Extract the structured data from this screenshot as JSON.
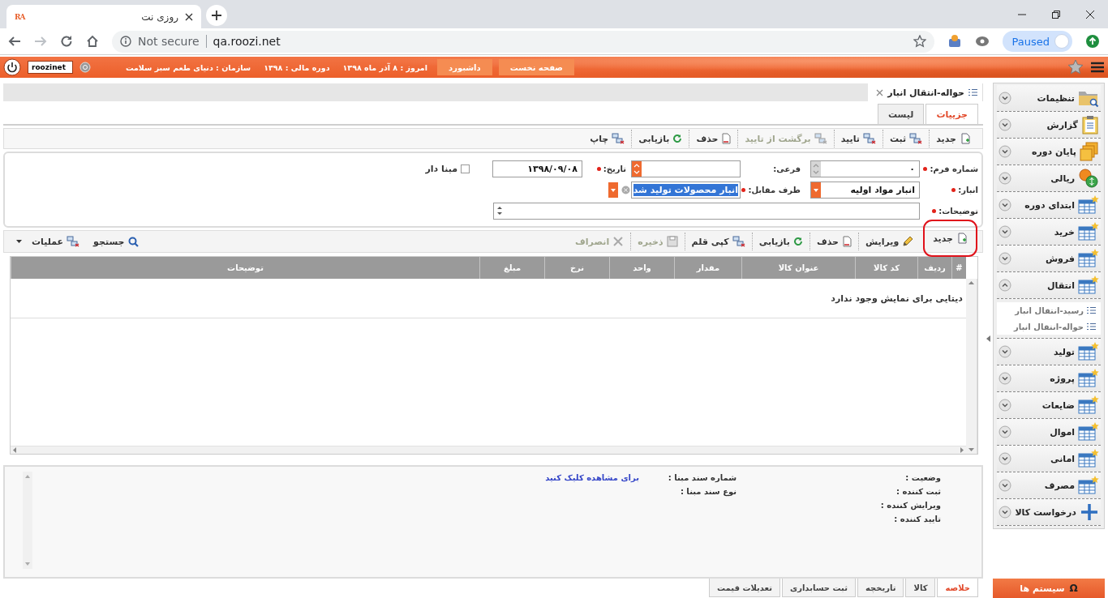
{
  "browser": {
    "favicon": "RA",
    "tab_title": "روزی نت",
    "security": "Not secure",
    "url": "qa.roozi.net",
    "profile_status": "Paused"
  },
  "header": {
    "buttons": [
      "صفحه نخست",
      "داشبورد"
    ],
    "info": [
      "امروز : ۸ آذر ماه ۱۳۹۸",
      "دوره مالی : ۱۳۹۸",
      "سازمان : دنیای طعم سبز سلامت"
    ],
    "user": "roozinet"
  },
  "document": {
    "title": "حواله-انتقال انبار",
    "tabs": [
      {
        "label": "جزییات",
        "selected": true
      },
      {
        "label": "لیست",
        "selected": false
      }
    ],
    "toolbar": [
      {
        "label": "جدید",
        "kind": "new",
        "disabled": false
      },
      {
        "label": "ثبت",
        "kind": "transfer",
        "disabled": false
      },
      {
        "label": "تایید",
        "kind": "transfer",
        "disabled": false
      },
      {
        "label": "برگشت از تایید",
        "kind": "transfer",
        "disabled": true
      },
      {
        "label": "حذف",
        "kind": "delete",
        "disabled": false
      },
      {
        "label": "بازیابی",
        "kind": "refresh",
        "disabled": false
      },
      {
        "label": "چاپ",
        "kind": "transfer",
        "disabled": false
      }
    ],
    "form": {
      "number": {
        "label": "شماره فرم:",
        "required": true,
        "value": "۰",
        "disabled": true
      },
      "sub": {
        "label": "فرعی:",
        "required": false,
        "disabled": false
      },
      "date": {
        "label": "تاریخ:",
        "required": true,
        "value": "۱۳۹۸/۰۹/۰۸"
      },
      "based": {
        "label": "مبنا دار",
        "checked": false
      },
      "warehouse": {
        "label": "انبار:",
        "required": true,
        "value": "انبار مواد اولیه"
      },
      "counterparty": {
        "label": "طرف مقابل:",
        "required": true,
        "value": "انبار محصولات تولید شد",
        "text_selected": true
      },
      "description": {
        "label": "توضیحات:",
        "required": true
      }
    },
    "grid_toolbar": {
      "items": [
        {
          "label": "جدید",
          "kind": "new",
          "disabled": false,
          "highlighted": true
        },
        {
          "label": "ویرایش",
          "kind": "edit",
          "disabled": false,
          "highlighted": false
        },
        {
          "label": "حذف",
          "kind": "delete",
          "disabled": false,
          "highlighted": false
        },
        {
          "label": "بازیابی",
          "kind": "refresh",
          "disabled": false,
          "highlighted": false
        },
        {
          "label": "کپی قلم",
          "kind": "transfer",
          "disabled": false,
          "highlighted": false
        },
        {
          "label": "ذخیره",
          "kind": "disk",
          "disabled": true,
          "highlighted": false
        },
        {
          "label": "انصراف",
          "kind": "cancel",
          "disabled": true,
          "highlighted": false
        }
      ],
      "tools": [
        {
          "label": "جستجو",
          "kind": "search",
          "menu": false
        },
        {
          "label": "عملیات",
          "kind": "transfer",
          "menu": true
        }
      ]
    },
    "table": {
      "columns": [
        "#",
        "ردیف",
        "کد کالا",
        "عنوان کالا",
        "مقدار",
        "واحد",
        "نرخ",
        "مبلغ",
        "توضیحات"
      ],
      "empty_message": "دیتایی برای نمایش وجود ندارد"
    },
    "summary": {
      "fields": [
        "وضعیت :",
        "ثبت کننده :",
        "ویرایش کننده :",
        "تایید کننده :"
      ],
      "source_fields": [
        "شماره سند مبنا :",
        "نوع سند مبنا :"
      ],
      "link": "برای مشاهده کلیک کنید"
    },
    "bottom_tabs": [
      {
        "label": "خلاصه",
        "selected": true
      },
      {
        "label": "کالا",
        "selected": false
      },
      {
        "label": "تاریخچه",
        "selected": false
      },
      {
        "label": "ثبت حسابداری",
        "selected": false
      },
      {
        "label": "تعدیلات قیمت",
        "selected": false
      }
    ]
  },
  "sidebar": {
    "items": [
      {
        "label": "تنظیمات",
        "kind": "folder",
        "expanded": false
      },
      {
        "label": "گزارش",
        "kind": "clipboard",
        "expanded": false
      },
      {
        "label": "پایان دوره",
        "kind": "stack",
        "expanded": false
      },
      {
        "label": "ریالی",
        "kind": "coins",
        "expanded": false
      },
      {
        "label": "ابتدای دوره",
        "kind": "table",
        "expanded": false
      },
      {
        "label": "خرید",
        "kind": "table",
        "expanded": false
      },
      {
        "label": "فروش",
        "kind": "table",
        "expanded": false
      },
      {
        "label": "انتقال",
        "kind": "table",
        "expanded": true,
        "children": [
          {
            "label": "رسید-انتقال انبار"
          },
          {
            "label": "حواله-انتقال انبار"
          }
        ]
      },
      {
        "label": "تولید",
        "kind": "table",
        "expanded": false
      },
      {
        "label": "پروژه",
        "kind": "table",
        "expanded": false
      },
      {
        "label": "ضایعات",
        "kind": "table",
        "expanded": false
      },
      {
        "label": "اموال",
        "kind": "table",
        "expanded": false
      },
      {
        "label": "امانی",
        "kind": "table",
        "expanded": false
      },
      {
        "label": "مصرف",
        "kind": "table",
        "expanded": false
      },
      {
        "label": "درخواست کالا",
        "kind": "plus",
        "expanded": false
      }
    ],
    "system_button": {
      "icon": "Ω",
      "label": "سیستم ها"
    }
  }
}
